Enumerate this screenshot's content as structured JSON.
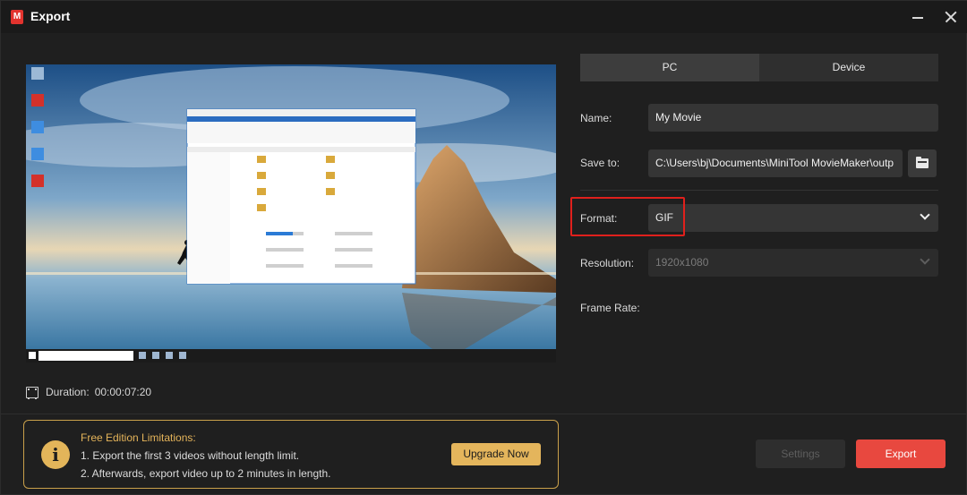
{
  "window": {
    "title": "Export",
    "logo_letter": "M"
  },
  "preview": {
    "taskbar_search_placeholder": "Type here to search",
    "explorer_title": "This PC"
  },
  "duration": {
    "label": "Duration:",
    "value": "00:00:07:20"
  },
  "tabs": [
    {
      "label": "PC"
    },
    {
      "label": "Device"
    }
  ],
  "form": {
    "name_label": "Name:",
    "name_value": "My Movie",
    "save_to_label": "Save to:",
    "save_to_value": "C:\\Users\\bj\\Documents\\MiniTool MovieMaker\\outp",
    "format_label": "Format:",
    "format_value": "GIF",
    "resolution_label": "Resolution:",
    "resolution_value": "1920x1080",
    "frame_rate_label": "Frame Rate:"
  },
  "limitations": {
    "title": "Free Edition Limitations:",
    "line1": "1. Export the first 3 videos without length limit.",
    "line2": "2. Afterwards, export video up to 2 minutes in length.",
    "upgrade_label": "Upgrade Now"
  },
  "actions": {
    "settings_label": "Settings",
    "export_label": "Export"
  },
  "colors": {
    "accent_export": "#e8483f",
    "accent_upgrade": "#e4b55c",
    "highlight": "#e0201c"
  }
}
